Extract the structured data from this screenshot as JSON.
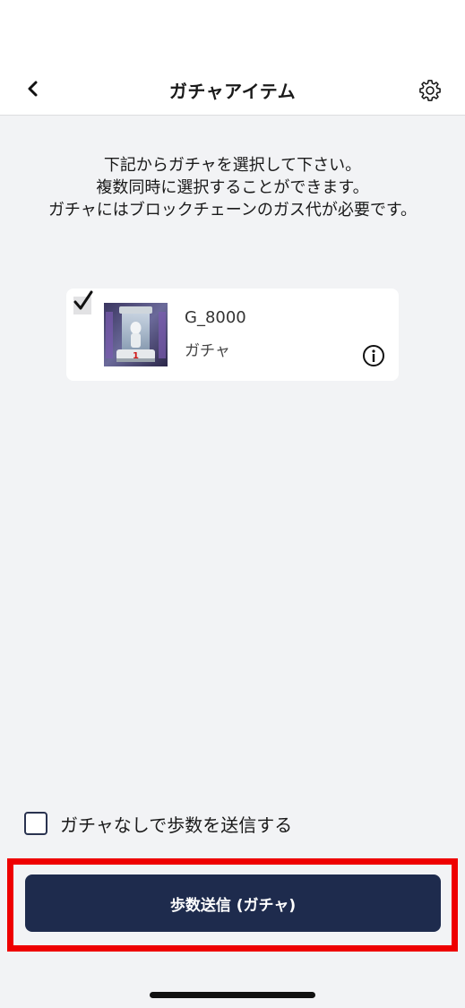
{
  "header": {
    "title": "ガチャアイテム",
    "back_icon": "chevron-left-icon",
    "settings_icon": "gear-icon"
  },
  "instructions": {
    "line1": "下記からガチャを選択して下さい。",
    "line2": "複数同時に選択することができます。",
    "line3": "ガチャにはブロックチェーンのガス代が必要です。"
  },
  "items": [
    {
      "name": "G_8000",
      "type": "ガチャ",
      "checked": true,
      "badge": "1",
      "info_icon": "info-icon"
    }
  ],
  "no_gacha": {
    "label": "ガチャなしで歩数を送信する",
    "checked": false
  },
  "submit": {
    "label": "歩数送信 (ガチャ)"
  },
  "colors": {
    "background": "#f2f3f5",
    "primary_button": "#1e2b4d",
    "highlight": "#ee0000"
  }
}
